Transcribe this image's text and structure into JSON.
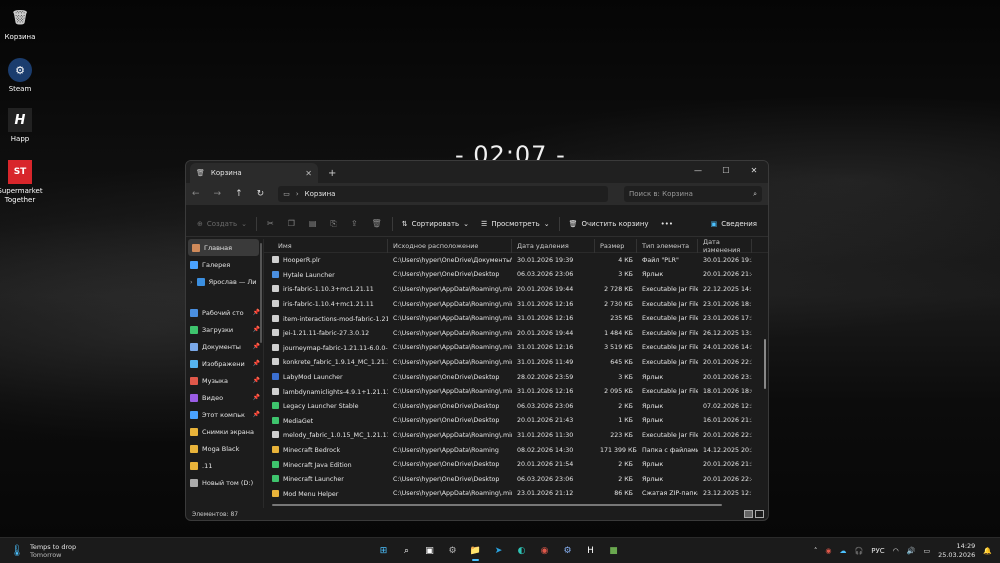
{
  "desktop": {
    "icons": [
      {
        "label": "Корзина",
        "icon": "recycle-bin-icon"
      },
      {
        "label": "Steam",
        "icon": "steam-icon"
      },
      {
        "label": "Happ",
        "icon": "happ-icon"
      },
      {
        "label": "Supermarket Together",
        "icon": "supermarket-together-icon"
      }
    ],
    "clock": "- 02:07 -"
  },
  "window": {
    "tab_title": "Корзина",
    "address": "Корзина",
    "search_placeholder": "Поиск в: Корзина",
    "toolbar": {
      "create": "Создать",
      "sort": "Сортировать",
      "view": "Просмотреть",
      "empty_bin": "Очистить корзину",
      "more": "•••",
      "details": "Сведения"
    },
    "sidebar": [
      {
        "label": "Главная",
        "color": "#d08a5a"
      },
      {
        "label": "Галерея",
        "color": "#4aa3ff"
      },
      {
        "label": "Ярослав — Ли",
        "color": "#3b8fe0"
      },
      {
        "label": "Рабочий сто",
        "color": "#4a8fe0"
      },
      {
        "label": "Загрузки",
        "color": "#3ec46d"
      },
      {
        "label": "Документы",
        "color": "#7aa8e8"
      },
      {
        "label": "Изображени",
        "color": "#56b4f0"
      },
      {
        "label": "Музыка",
        "color": "#e0584a"
      },
      {
        "label": "Видео",
        "color": "#9b5de5"
      },
      {
        "label": "Этот компьк",
        "color": "#4aa3ff"
      },
      {
        "label": "Снимки экрана",
        "color": "#e8b33a"
      },
      {
        "label": "Moga Black",
        "color": "#e8b33a"
      },
      {
        ".11": ".11",
        "label": ".11",
        "color": "#e8b33a"
      },
      {
        "label": "Новый том (D:)",
        "color": "#aaaaaa"
      }
    ],
    "columns": [
      "Имя",
      "Исходное расположение",
      "Дата удаления",
      "Размер",
      "Тип элемента",
      "Дата изменения"
    ],
    "rows": [
      [
        "HooperR.plr",
        "C:\\Users\\hyper\\OneDrive\\Документы\\M...",
        "30.01.2026 19:39",
        "4 КБ",
        "Файл \"PLR\"",
        "30.01.2026 19:39"
      ],
      [
        "Hytale Launcher",
        "C:\\Users\\hyper\\OneDrive\\Desktop",
        "06.03.2026 23:06",
        "3 КБ",
        "Ярлык",
        "20.01.2026 21:45"
      ],
      [
        "iris-fabric-1.10.3+mc1.21.11",
        "C:\\Users\\hyper\\AppData\\Roaming\\.min...",
        "20.01.2026 19:44",
        "2 728 КБ",
        "Executable Jar File",
        "22.12.2025 14:10"
      ],
      [
        "iris-fabric-1.10.4+mc1.21.11",
        "C:\\Users\\hyper\\AppData\\Roaming\\.min...",
        "31.01.2026 12:16",
        "2 730 КБ",
        "Executable Jar File",
        "23.01.2026 18:12"
      ],
      [
        "item-interactions-mod-fabric-1.21...",
        "C:\\Users\\hyper\\AppData\\Roaming\\.min...",
        "31.01.2026 12:16",
        "235 КБ",
        "Executable Jar File",
        "23.01.2026 17:59"
      ],
      [
        "jei-1.21.11-fabric-27.3.0.12",
        "C:\\Users\\hyper\\AppData\\Roaming\\.min...",
        "20.01.2026 19:44",
        "1 484 КБ",
        "Executable Jar File",
        "26.12.2025 13:31"
      ],
      [
        "journeymap-fabric-1.21.11-6.0.0-b...",
        "C:\\Users\\hyper\\AppData\\Roaming\\.min...",
        "31.01.2026 12:16",
        "3 519 КБ",
        "Executable Jar File",
        "24.01.2026 14:24"
      ],
      [
        "konkrete_fabric_1.9.14_MC_1.21.11",
        "C:\\Users\\hyper\\AppData\\Roaming\\.min...",
        "31.01.2026 11:49",
        "645 КБ",
        "Executable Jar File",
        "20.01.2026 22:22"
      ],
      [
        "LabyMod Launcher",
        "C:\\Users\\hyper\\OneDrive\\Desktop",
        "28.02.2026 23:59",
        "3 КБ",
        "Ярлык",
        "20.01.2026 23:36"
      ],
      [
        "lambdynamiclights-4.9.1+1.21.11",
        "C:\\Users\\hyper\\AppData\\Roaming\\.min...",
        "31.01.2026 12:16",
        "2 095 КБ",
        "Executable Jar File",
        "18.01.2026 18:01"
      ],
      [
        "Legacy Launcher Stable",
        "C:\\Users\\hyper\\OneDrive\\Desktop",
        "06.03.2026 23:06",
        "2 КБ",
        "Ярлык",
        "07.02.2026 12:53"
      ],
      [
        "MediaGet",
        "C:\\Users\\hyper\\OneDrive\\Desktop",
        "20.01.2026 21:43",
        "1 КБ",
        "Ярлык",
        "16.01.2026 21:30"
      ],
      [
        "melody_fabric_1.0.15_MC_1.21.11",
        "C:\\Users\\hyper\\AppData\\Roaming\\.min...",
        "31.01.2026 11:30",
        "223 КБ",
        "Executable Jar File",
        "20.01.2026 22:22"
      ],
      [
        "Minecraft Bedrock",
        "C:\\Users\\hyper\\AppData\\Roaming",
        "08.02.2026 14:30",
        "171 399 КБ",
        "Папка с файлами",
        "14.12.2025 20:25"
      ],
      [
        "Minecraft Java Edition",
        "C:\\Users\\hyper\\OneDrive\\Desktop",
        "20.01.2026 21:54",
        "2 КБ",
        "Ярлык",
        "20.01.2026 21:54"
      ],
      [
        "Minecraft Launcher",
        "C:\\Users\\hyper\\OneDrive\\Desktop",
        "06.03.2026 23:06",
        "2 КБ",
        "Ярлык",
        "20.01.2026 22:44"
      ],
      [
        "Mod Menu Helper",
        "C:\\Users\\hyper\\AppData\\Roaming\\.min...",
        "23.01.2026 21:12",
        "86 КБ",
        "Сжатая ZIP-папка",
        "23.12.2025 12:15"
      ]
    ],
    "row_icon_colors": [
      "#cfcfcf",
      "#4a8fe0",
      "#cfcfcf",
      "#cfcfcf",
      "#cfcfcf",
      "#cfcfcf",
      "#cfcfcf",
      "#cfcfcf",
      "#3b6fd0",
      "#cfcfcf",
      "#3ec46d",
      "#3ec46d",
      "#cfcfcf",
      "#e8b33a",
      "#3ec46d",
      "#3ec46d",
      "#e8b33a"
    ],
    "status": "Элементов: 87"
  },
  "taskbar": {
    "weather_line1": "Temps to drop",
    "weather_line2": "Tomorrow",
    "apps": [
      {
        "icon": "start-icon",
        "color": "#4cc2ff"
      },
      {
        "icon": "search-icon",
        "color": "#ffffff"
      },
      {
        "icon": "task-view-icon",
        "color": "#ffffff"
      },
      {
        "icon": "settings-icon",
        "color": "#bbbbbb"
      },
      {
        "icon": "file-explorer-icon",
        "color": "#e8b33a"
      },
      {
        "icon": "telegram-icon",
        "color": "#2aa3e0"
      },
      {
        "icon": "edge-icon",
        "color": "#2ec4b6"
      },
      {
        "icon": "chrome-icon",
        "color": "#e0584a"
      },
      {
        "icon": "steam-icon",
        "color": "#8ab4f8"
      },
      {
        "icon": "happ-icon",
        "color": "#ffffff"
      },
      {
        "icon": "minecraft-icon",
        "color": "#6aa84f"
      }
    ],
    "lang": "РУС",
    "time": "14:29",
    "date": "25.03.2026"
  }
}
